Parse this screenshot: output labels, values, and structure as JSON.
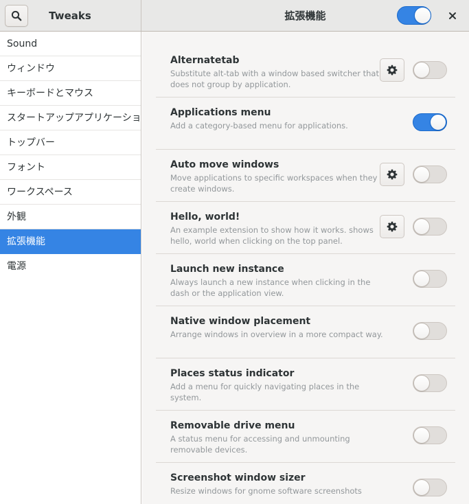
{
  "app": {
    "title": "Tweaks",
    "panel_title": "拡張機能",
    "global_switch_on": true
  },
  "sidebar": {
    "items": [
      {
        "label": "Sound",
        "selected": false
      },
      {
        "label": "ウィンドウ",
        "selected": false
      },
      {
        "label": "キーボードとマウス",
        "selected": false
      },
      {
        "label": "スタートアップアプリケーション",
        "selected": false
      },
      {
        "label": "トップバー",
        "selected": false
      },
      {
        "label": "フォント",
        "selected": false
      },
      {
        "label": "ワークスペース",
        "selected": false
      },
      {
        "label": "外観",
        "selected": false
      },
      {
        "label": "拡張機能",
        "selected": true
      },
      {
        "label": "電源",
        "selected": false
      }
    ]
  },
  "extensions": [
    {
      "name": "Alternatetab",
      "desc": "Substitute alt-tab with a window based switcher that does not group by application.",
      "settings": true,
      "enabled": false
    },
    {
      "name": "Applications menu",
      "desc": "Add a category-based menu for applications.",
      "settings": false,
      "enabled": true
    },
    {
      "name": "Auto move windows",
      "desc": "Move applications to specific workspaces when they create windows.",
      "settings": true,
      "enabled": false
    },
    {
      "name": "Hello, world!",
      "desc": "An example extension to show how it works. shows hello, world when clicking on the top panel.",
      "settings": true,
      "enabled": false
    },
    {
      "name": "Launch new instance",
      "desc": "Always launch a new instance when clicking in the dash or the application view.",
      "settings": false,
      "enabled": false
    },
    {
      "name": "Native window placement",
      "desc": "Arrange windows in overview in a more compact way.",
      "settings": false,
      "enabled": false
    },
    {
      "name": "Places status indicator",
      "desc": "Add a menu for quickly navigating places in the system.",
      "settings": false,
      "enabled": false
    },
    {
      "name": "Removable drive menu",
      "desc": "A status menu for accessing and unmounting removable devices.",
      "settings": false,
      "enabled": false
    },
    {
      "name": "Screenshot window sizer",
      "desc": "Resize windows for gnome software screenshots",
      "settings": false,
      "enabled": false
    }
  ],
  "icons": {
    "search": "search-icon",
    "close": "close-icon",
    "gear": "gear-icon"
  },
  "colors": {
    "accent": "#3584e4",
    "sidebar_selected_text": "#ffffff",
    "description_text": "#92979a"
  }
}
